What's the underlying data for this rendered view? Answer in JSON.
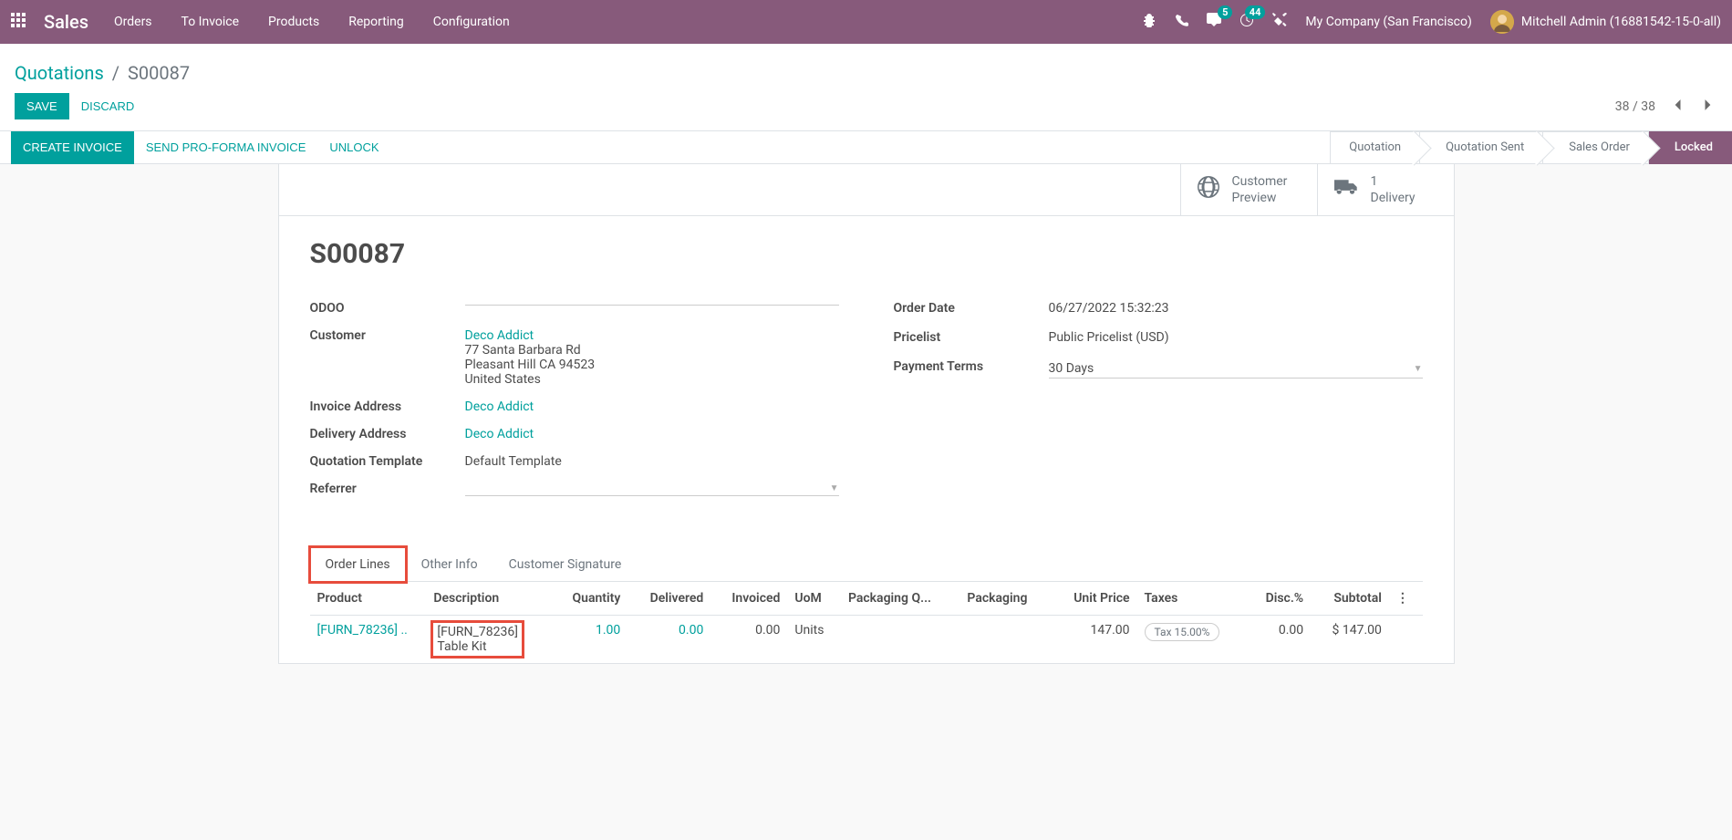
{
  "navbar": {
    "brand": "Sales",
    "menu": [
      "Orders",
      "To Invoice",
      "Products",
      "Reporting",
      "Configuration"
    ],
    "messages_badge": "5",
    "activities_badge": "44",
    "company": "My Company (San Francisco)",
    "user": "Mitchell Admin (16881542-15-0-all)"
  },
  "breadcrumb": {
    "parent": "Quotations",
    "current": "S00087"
  },
  "cp": {
    "save": "Save",
    "discard": "Discard",
    "pager": "38 / 38"
  },
  "statusbar": {
    "buttons": {
      "create_invoice": "Create Invoice",
      "send_proforma": "Send Pro-Forma Invoice",
      "unlock": "Unlock"
    },
    "steps": [
      "Quotation",
      "Quotation Sent",
      "Sales Order",
      "Locked"
    ]
  },
  "stat_buttons": {
    "preview": {
      "line1": "Customer",
      "line2": "Preview"
    },
    "delivery": {
      "line1": "1",
      "line2": "Delivery"
    }
  },
  "record": {
    "name": "S00087",
    "odoo_label": "ODOO",
    "customer_label": "Customer",
    "customer_name": "Deco Addict",
    "customer_street": "77 Santa Barbara Rd",
    "customer_city": "Pleasant Hill CA 94523",
    "customer_country": "United States",
    "invoice_address_label": "Invoice Address",
    "invoice_address": "Deco Addict",
    "delivery_address_label": "Delivery Address",
    "delivery_address": "Deco Addict",
    "quotation_template_label": "Quotation Template",
    "quotation_template": "Default Template",
    "referrer_label": "Referrer",
    "order_date_label": "Order Date",
    "order_date": "06/27/2022 15:32:23",
    "pricelist_label": "Pricelist",
    "pricelist": "Public Pricelist (USD)",
    "payment_terms_label": "Payment Terms",
    "payment_terms": "30 Days"
  },
  "tabs": {
    "order_lines": "Order Lines",
    "other_info": "Other Info",
    "customer_signature": "Customer Signature"
  },
  "table": {
    "headers": {
      "product": "Product",
      "description": "Description",
      "quantity": "Quantity",
      "delivered": "Delivered",
      "invoiced": "Invoiced",
      "uom": "UoM",
      "packaging_qty": "Packaging Q...",
      "packaging": "Packaging",
      "unit_price": "Unit Price",
      "taxes": "Taxes",
      "disc": "Disc.%",
      "subtotal": "Subtotal"
    },
    "row": {
      "product": "[FURN_78236] ..",
      "description_l1": "[FURN_78236]",
      "description_l2": "Table Kit",
      "quantity": "1.00",
      "delivered": "0.00",
      "invoiced": "0.00",
      "uom": "Units",
      "unit_price": "147.00",
      "taxes": "Tax 15.00%",
      "disc": "0.00",
      "subtotal": "$ 147.00"
    }
  }
}
